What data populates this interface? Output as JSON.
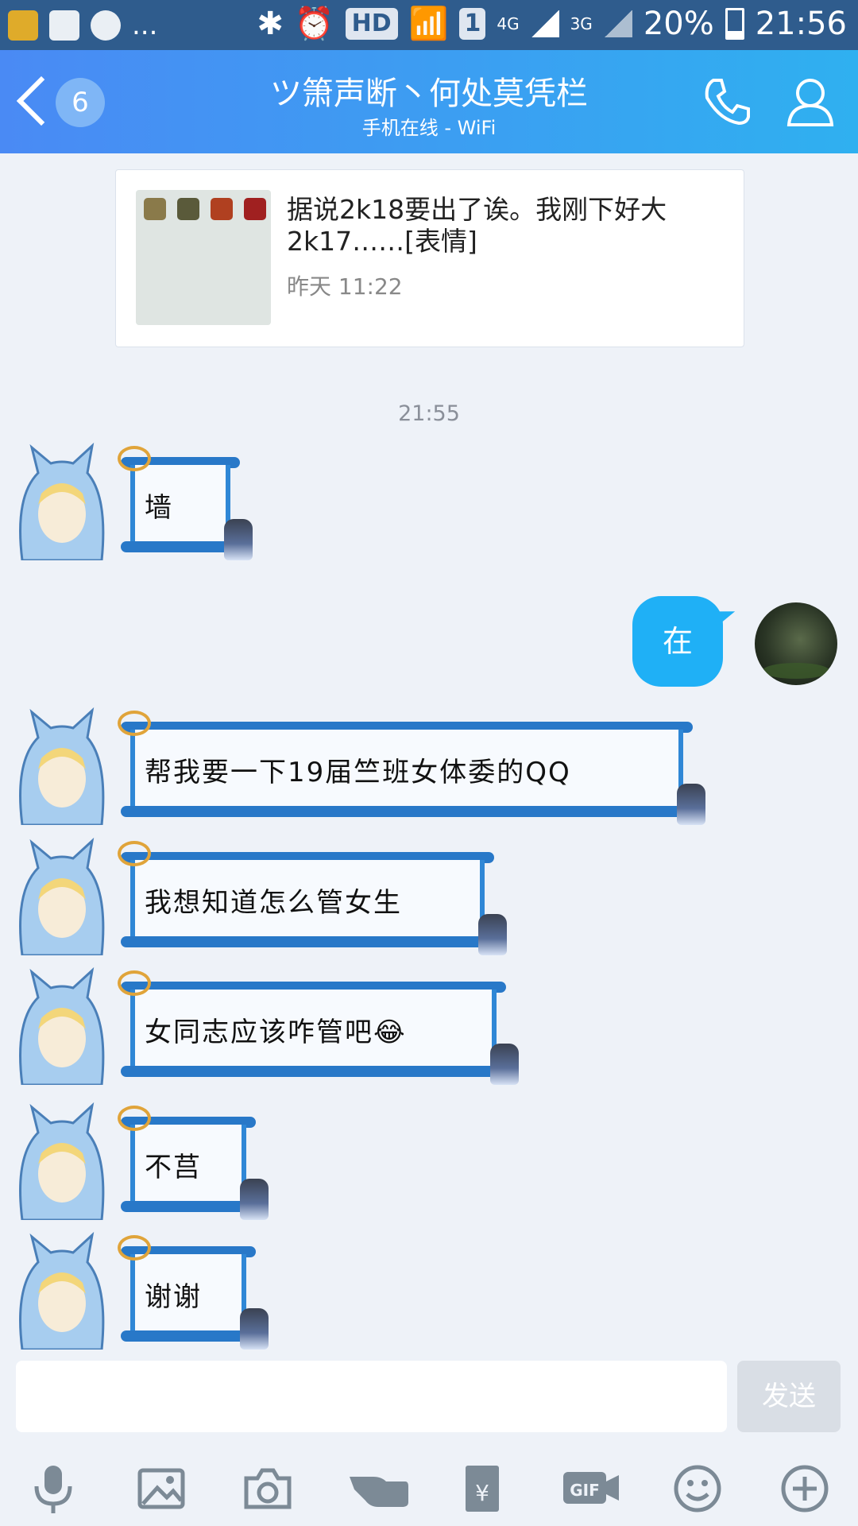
{
  "status_bar": {
    "battery": "20%",
    "time": "21:56",
    "hd": "HD",
    "sim": "1",
    "net1": "4G",
    "net2": "3G",
    "dots": "..."
  },
  "header": {
    "unread_badge": "6",
    "title": "ツ箫声断丶何处莫凭栏",
    "subtitle": "手机在线 - WiFi"
  },
  "shared_card": {
    "text": "据说2k18要出了诶。我刚下好大2k17……[表情]",
    "time": "昨天 11:22"
  },
  "timestamp": "21:55",
  "messages": [
    {
      "side": "left",
      "text": "墙"
    },
    {
      "side": "right",
      "text": "在"
    },
    {
      "side": "left",
      "text": "帮我要一下19届竺班女体委的QQ"
    },
    {
      "side": "left",
      "text": "我想知道怎么管女生"
    },
    {
      "side": "left",
      "text": "女同志应该咋管吧😂"
    },
    {
      "side": "left",
      "text": "不莒"
    },
    {
      "side": "left",
      "text": "谢谢"
    }
  ],
  "input": {
    "send_label": "发送",
    "placeholder": ""
  },
  "toolbar": [
    "mic-icon",
    "image-icon",
    "camera-icon",
    "poke-icon",
    "red-packet-icon",
    "gif-icon",
    "emoji-icon",
    "plus-icon"
  ],
  "colors": {
    "header_start": "#4a8af4",
    "header_end": "#2fb0f0",
    "bubble_right": "#1fb0f6",
    "background": "#eef2f8"
  }
}
